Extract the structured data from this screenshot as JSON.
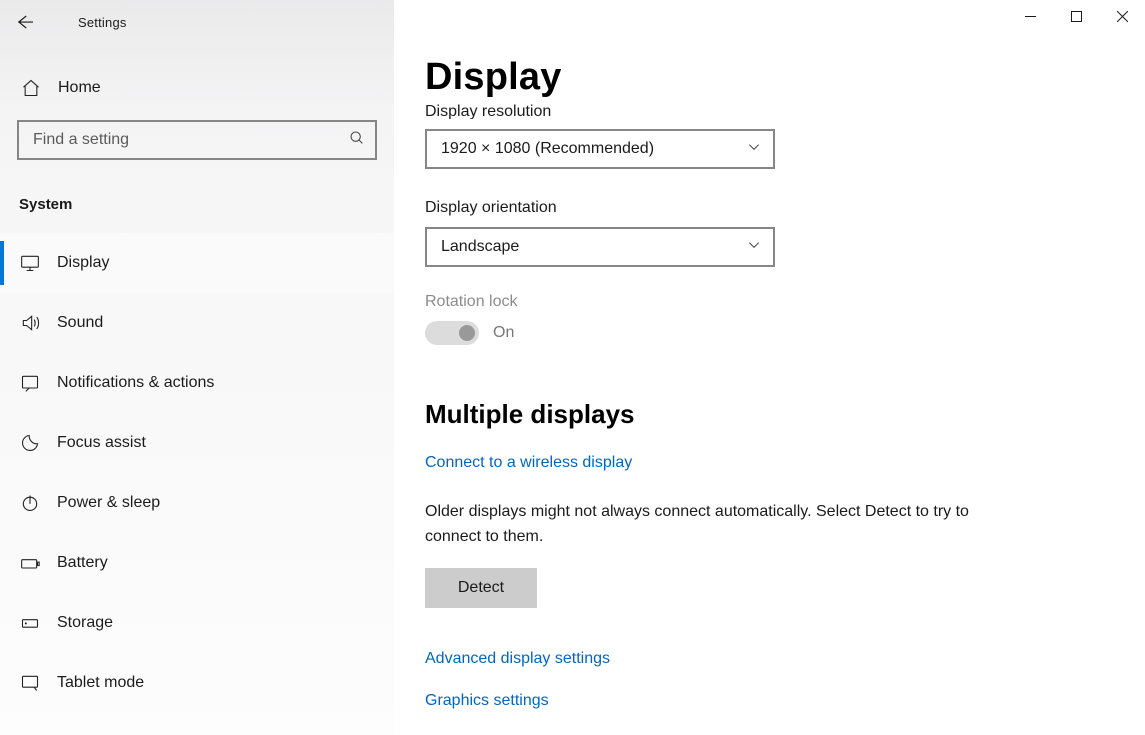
{
  "window": {
    "app_title": "Settings"
  },
  "sidebar": {
    "home_label": "Home",
    "search_placeholder": "Find a setting",
    "section_heading": "System",
    "items": [
      {
        "label": "Display",
        "active": true
      },
      {
        "label": "Sound"
      },
      {
        "label": "Notifications & actions"
      },
      {
        "label": "Focus assist"
      },
      {
        "label": "Power & sleep"
      },
      {
        "label": "Battery"
      },
      {
        "label": "Storage"
      },
      {
        "label": "Tablet mode"
      }
    ]
  },
  "main": {
    "page_title": "Display",
    "display_resolution_label": "Display resolution",
    "display_resolution_value": "1920 × 1080 (Recommended)",
    "display_orientation_label": "Display orientation",
    "display_orientation_value": "Landscape",
    "rotation_lock_label": "Rotation lock",
    "rotation_lock_state": "On",
    "multiple_displays_heading": "Multiple displays",
    "wireless_display_link": "Connect to a wireless display",
    "detect_help_text": "Older displays might not always connect automatically. Select Detect to try to connect to them.",
    "detect_button": "Detect",
    "advanced_link": "Advanced display settings",
    "graphics_link": "Graphics settings"
  }
}
